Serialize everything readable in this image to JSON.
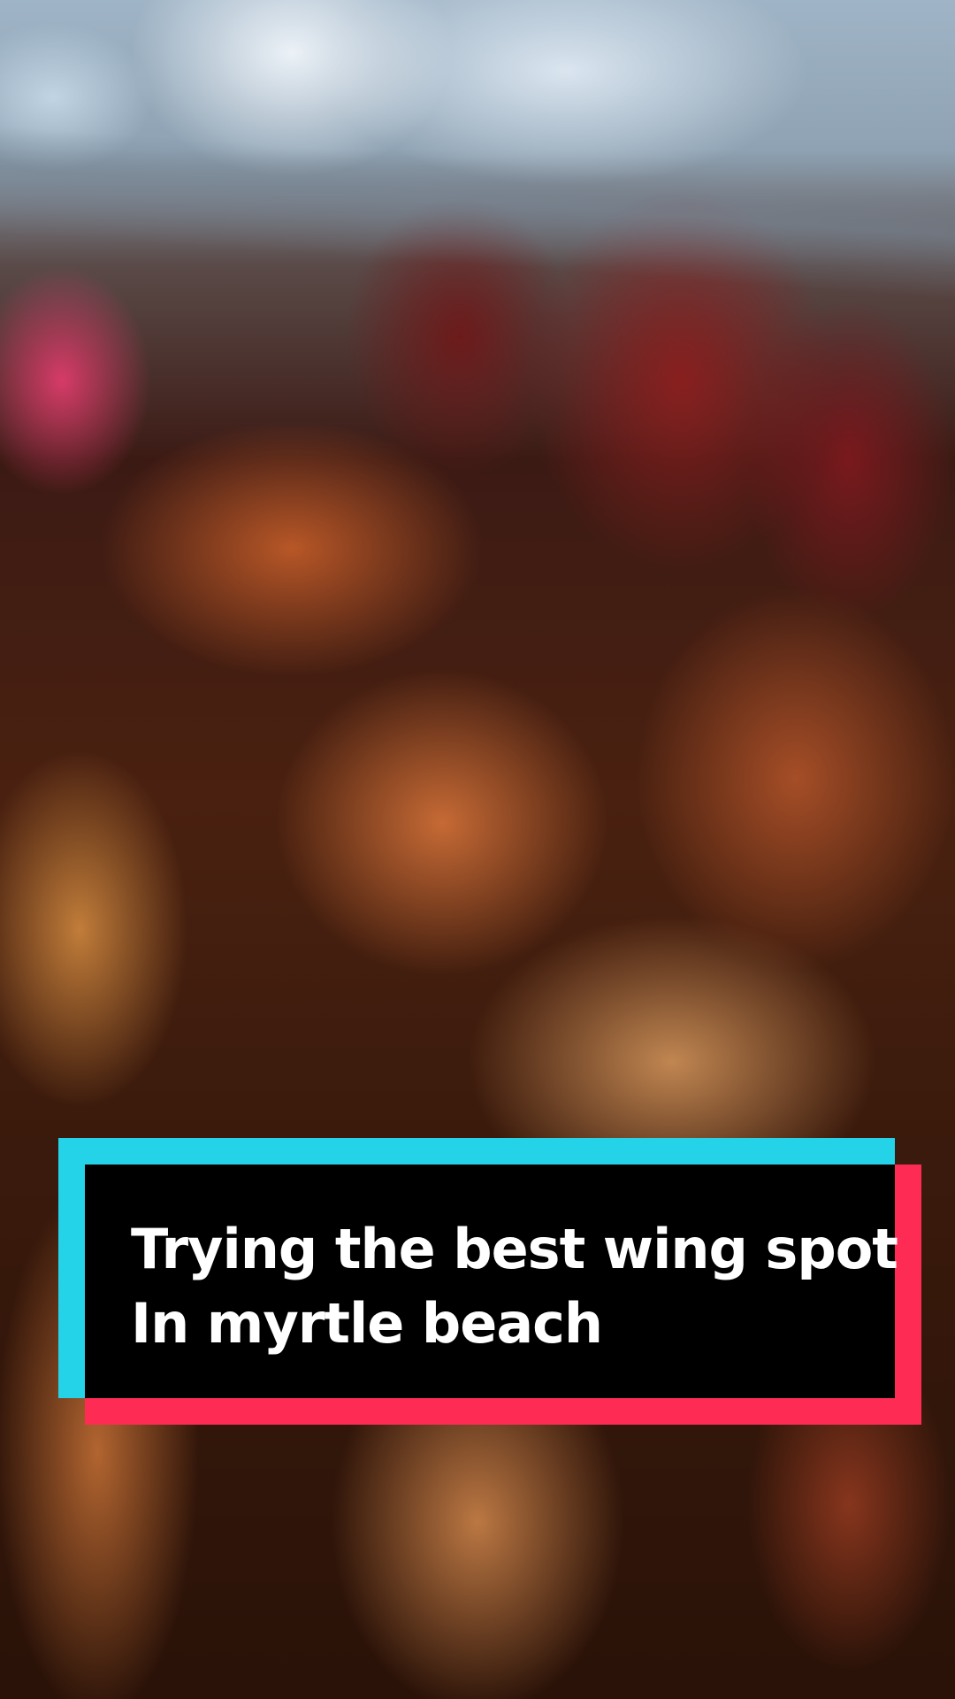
{
  "caption": {
    "line1": "Trying the best wing spot",
    "line2": "In myrtle beach"
  },
  "colors": {
    "caption_background": "#000000",
    "caption_text": "#ffffff",
    "accent_cyan": "#25d3e8",
    "accent_red": "#fe2c55"
  }
}
